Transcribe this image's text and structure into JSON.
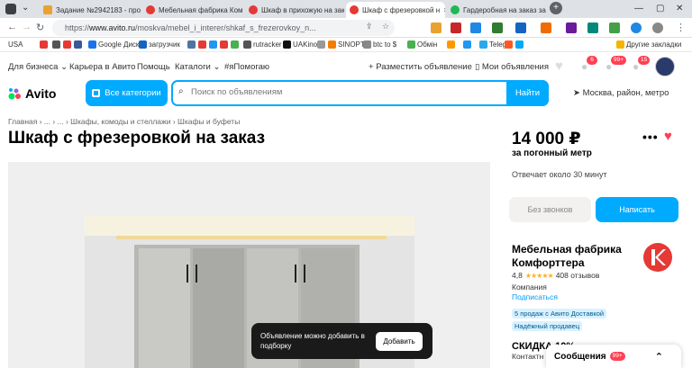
{
  "browser": {
    "tabs": [
      {
        "label": "Задание №2942183 - про",
        "color": "#e9a230"
      },
      {
        "label": "Мебельная фабрика Ком",
        "color": "#e53935"
      },
      {
        "label": "Шкаф в прихожую на зак",
        "color": "#e53935"
      },
      {
        "label": "Шкаф с фрезеровкой н",
        "color": "#e53935",
        "active": true
      },
      {
        "label": "Гардеробная на заказ за",
        "color": "#1db954"
      }
    ],
    "url_prefix": "https://",
    "url_host": "www.avito.ru",
    "url_path": "/moskva/mebel_i_interer/shkaf_s_frezerovkoy_n..."
  },
  "bookmarks": [
    {
      "label": "USA",
      "color": "#888"
    },
    {
      "label": "",
      "color": "#e53935"
    },
    {
      "label": "",
      "color": "#555"
    },
    {
      "label": "",
      "color": "#e53935"
    },
    {
      "label": "",
      "color": "#3b5998"
    },
    {
      "label": "Google Диск",
      "color": "#1a73e8"
    },
    {
      "label": "загрузчик",
      "color": "#1565c0"
    },
    {
      "label": "",
      "color": "#4c75a3"
    },
    {
      "label": "",
      "color": "#e53935"
    },
    {
      "label": "",
      "color": "#2196f3"
    },
    {
      "label": "",
      "color": "#e53935"
    },
    {
      "label": "",
      "color": "#4caf50"
    },
    {
      "label": "rutracker",
      "color": "#555"
    },
    {
      "label": "UAKino",
      "color": "#111"
    },
    {
      "label": "",
      "color": "#999"
    },
    {
      "label": "SINOPTIK",
      "color": "#f57c00"
    },
    {
      "label": "btc to $",
      "color": "#888"
    },
    {
      "label": "Обмін",
      "color": "#4caf50"
    },
    {
      "label": "",
      "color": "#ff9800"
    },
    {
      "label": "",
      "color": "#2196f3"
    },
    {
      "label": "Telegr",
      "color": "#29a9eb"
    },
    {
      "label": "",
      "color": "#ff5722"
    },
    {
      "label": "",
      "color": "#03a9f4"
    },
    {
      "label": "Другие закладки",
      "color": "#f4b400"
    }
  ],
  "topnav": {
    "business": "Для бизнеса",
    "career": "Карьера в Авито",
    "help": "Помощь",
    "catalogs": "Каталоги",
    "help_tag": "#яПомогаю",
    "post_ad": "Разместить объявление",
    "my_ads": "Мои объявления",
    "badges": {
      "notifications": "6",
      "messages": "99+",
      "cart": "15"
    }
  },
  "search": {
    "logo": "Avito",
    "categories": "Все категории",
    "placeholder": "Поиск по объявлениям",
    "button": "Найти",
    "location": "Москва, район, метро"
  },
  "breadcrumb": "Главная  ›  ...  ›  ...  ›  Шкафы, комоды и стеллажи  ›  Шкафы и буфеты",
  "listing": {
    "title": "Шкаф с фрезеровкой на заказ",
    "price": "14 000 ₽",
    "price_unit": "за погонный метр",
    "reply_time": "Отвечает около 30 минут",
    "no_calls": "Без звонков",
    "write": "Написать"
  },
  "seller": {
    "name": "Мебельная фабрика Комфорттера",
    "rating": "4,8",
    "stars": "★★★★★",
    "reviews": "408 отзывов",
    "type": "Компания",
    "subscribe": "Подписаться",
    "tag1": "5 продаж с Авито Доставкой",
    "tag2": "Надёжный продавец",
    "discount": "СКИДКА 10%",
    "contacts": "Контактн"
  },
  "messages": {
    "label": "Сообщения",
    "badge": "99+"
  },
  "toast": {
    "text": "Объявление можно добавить в подборку",
    "button": "Добавить"
  }
}
